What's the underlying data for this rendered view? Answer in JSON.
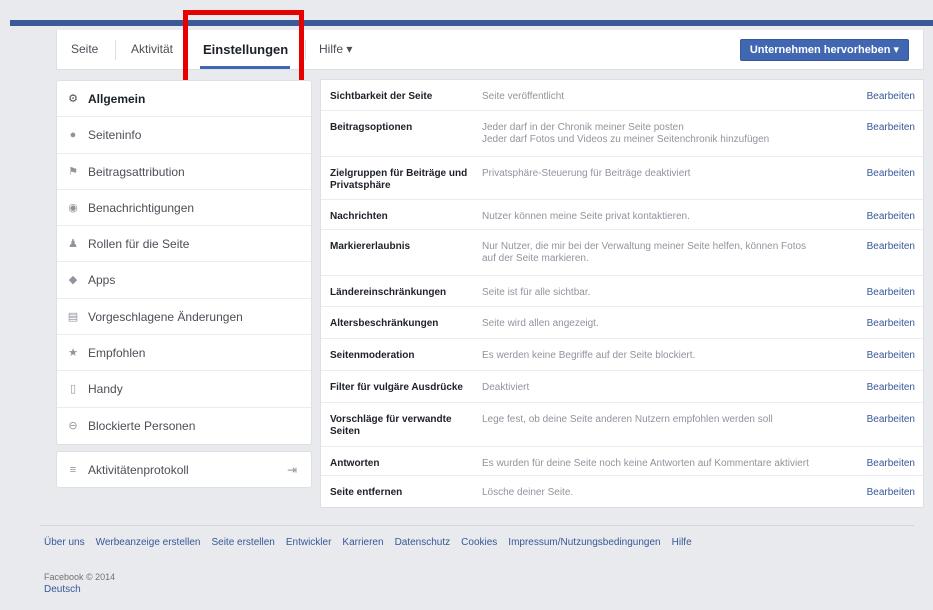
{
  "tabs": [
    {
      "label": "Seite"
    },
    {
      "label": "Aktivität"
    },
    {
      "label": "Einstellungen"
    },
    {
      "label": "Hilfe ▾"
    }
  ],
  "promote_button": "Unternehmen hervorheben ▾",
  "nav": [
    {
      "label": "Allgemein",
      "icon": "⚙"
    },
    {
      "label": "Seiteninfo",
      "icon": "●"
    },
    {
      "label": "Beitragsattribution",
      "icon": "⚑"
    },
    {
      "label": "Benachrichtigungen",
      "icon": "◉"
    },
    {
      "label": "Rollen für die Seite",
      "icon": "♟"
    },
    {
      "label": "Apps",
      "icon": "◆"
    },
    {
      "label": "Vorgeschlagene Änderungen",
      "icon": "▤"
    },
    {
      "label": "Empfohlen",
      "icon": "★"
    },
    {
      "label": "Handy",
      "icon": "▯"
    },
    {
      "label": "Blockierte Personen",
      "icon": "⊖"
    }
  ],
  "activity_log": {
    "label": "Aktivitätenprotokoll",
    "icon": "≡",
    "exit_icon": "⇥"
  },
  "settings": [
    {
      "name": "Sichtbarkeit der Seite",
      "desc": "Seite veröffentlicht",
      "edit": "Bearbeiten"
    },
    {
      "name": "Beitragsoptionen",
      "desc": "Jeder darf in der Chronik meiner Seite posten",
      "desc2": "Jeder darf Fotos und Videos zu meiner Seitenchronik hinzufügen",
      "edit": "Bearbeiten"
    },
    {
      "name": "Zielgruppen für Beiträge und",
      "name2": "Privatsphäre",
      "desc": "Privatsphäre-Steuerung für Beiträge deaktiviert",
      "edit": "Bearbeiten"
    },
    {
      "name": "Nachrichten",
      "desc": "Nutzer können meine Seite privat kontaktieren.",
      "edit": "Bearbeiten"
    },
    {
      "name": "Markiererlaubnis",
      "desc": "Nur Nutzer, die mir bei der Verwaltung meiner Seite helfen, können Fotos",
      "desc2": "auf der Seite markieren.",
      "edit": "Bearbeiten"
    },
    {
      "name": "Ländereinschränkungen",
      "desc": "Seite ist für alle sichtbar.",
      "edit": "Bearbeiten"
    },
    {
      "name": "Altersbeschränkungen",
      "desc": "Seite wird allen angezeigt.",
      "edit": "Bearbeiten"
    },
    {
      "name": "Seitenmoderation",
      "desc": "Es werden keine Begriffe auf der Seite blockiert.",
      "edit": "Bearbeiten"
    },
    {
      "name": "Filter für vulgäre Ausdrücke",
      "desc": "Deaktiviert",
      "edit": "Bearbeiten"
    },
    {
      "name": "Vorschläge für verwandte",
      "name2": "Seiten",
      "desc": "Lege fest, ob deine Seite anderen Nutzern empfohlen werden soll",
      "edit": "Bearbeiten"
    },
    {
      "name": "Antworten",
      "desc": "Es wurden für deine Seite noch keine Antworten auf Kommentare aktiviert",
      "edit": "Bearbeiten"
    },
    {
      "name": "Seite entfernen",
      "desc": "Lösche deiner Seite.",
      "edit": "Bearbeiten"
    }
  ],
  "footer": {
    "links": [
      "Über uns",
      "Werbeanzeige erstellen",
      "Seite erstellen",
      "Entwickler",
      "Karrieren",
      "Datenschutz",
      "Cookies",
      "Impressum/Nutzungsbedingungen",
      "Hilfe"
    ],
    "copyright": "Facebook © 2014",
    "language": "Deutsch"
  },
  "colors": {
    "brand": "#3b5998",
    "link": "#365899",
    "highlight": "#e60000"
  }
}
